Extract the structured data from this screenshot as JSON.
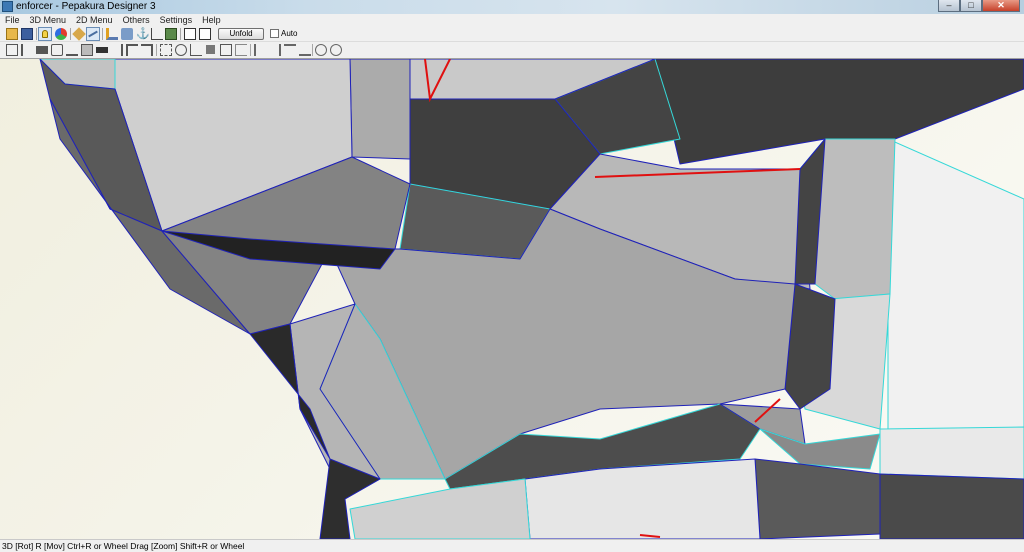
{
  "window": {
    "title": "enforcer - Pepakura Designer 3",
    "minimize_icon": "minimize-icon",
    "maximize_icon": "maximize-icon",
    "close_icon": "close-icon"
  },
  "menu": {
    "items": [
      "File",
      "3D Menu",
      "2D Menu",
      "Others",
      "Settings",
      "Help"
    ]
  },
  "toolbar": {
    "unfold_label": "Unfold",
    "auto_label": "Auto",
    "auto_checked": false
  },
  "statusbar": {
    "text": "3D [Rot] R [Mov] Ctrl+R or Wheel Drag [Zoom] Shift+R or Wheel"
  },
  "colors": {
    "edge": "#1f22b8",
    "fold_edge": "#35d8d8",
    "cut_edge": "#e01010",
    "face_light": "#c8c8c8",
    "face_dark": "#3c3c3c"
  }
}
